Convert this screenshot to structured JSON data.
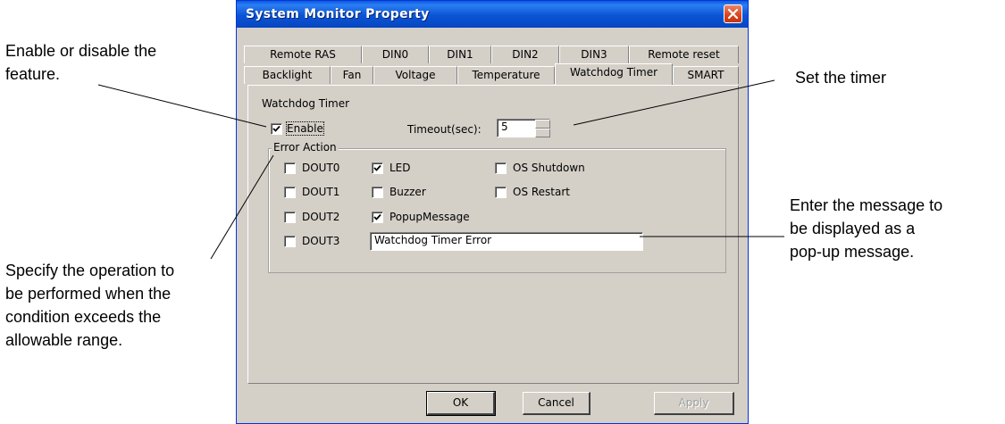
{
  "callouts": {
    "enable": [
      "Enable or disable the",
      "feature."
    ],
    "operation": [
      "Specify the operation to",
      "be performed when the",
      "condition exceeds the",
      "allowable range."
    ],
    "timer": "Set the timer",
    "message": [
      "Enter the message to",
      "be displayed as a",
      "pop-up message."
    ]
  },
  "window": {
    "title": "System Monitor Property",
    "tabs_row1": [
      "Remote RAS",
      "DIN0",
      "DIN1",
      "DIN2",
      "DIN3",
      "Remote reset"
    ],
    "tabs_row2": [
      "Backlight",
      "Fan",
      "Voltage",
      "Temperature",
      "Watchdog Timer",
      "SMART"
    ],
    "active_tab": "Watchdog Timer"
  },
  "watchdog": {
    "section_label": "Watchdog Timer",
    "enable_label": "Enable",
    "enable_checked": true,
    "timeout_label": "Timeout(sec):",
    "timeout_value": "5"
  },
  "error_action": {
    "legend": "Error Action",
    "dout0": {
      "label": "DOUT0",
      "checked": false
    },
    "dout1": {
      "label": "DOUT1",
      "checked": false
    },
    "dout2": {
      "label": "DOUT2",
      "checked": false
    },
    "dout3": {
      "label": "DOUT3",
      "checked": false
    },
    "led": {
      "label": "LED",
      "checked": true
    },
    "buzzer": {
      "label": "Buzzer",
      "checked": false
    },
    "popup": {
      "label": "PopupMessage",
      "checked": true
    },
    "os_shutdown": {
      "label": "OS Shutdown",
      "checked": false
    },
    "os_restart": {
      "label": "OS Restart",
      "checked": false
    },
    "message_value": "Watchdog Timer Error"
  },
  "buttons": {
    "ok": "OK",
    "cancel": "Cancel",
    "apply": "Apply"
  },
  "colors": {
    "title_bar": "#0a54d4",
    "dialog_bg": "#d4d0c8",
    "close_button": "#d7431c"
  }
}
